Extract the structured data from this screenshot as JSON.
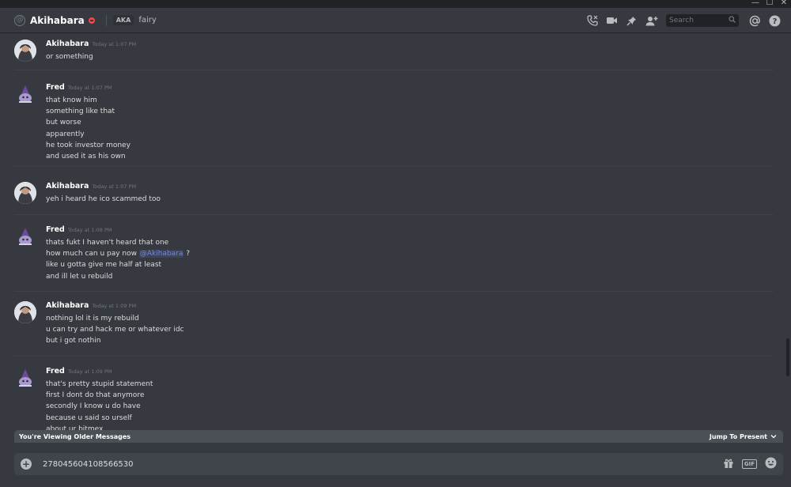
{
  "window": {
    "minimize": "—",
    "maximize": "☐",
    "close": "✕"
  },
  "header": {
    "name": "Akihabara",
    "aka_label": "AKA",
    "nickname": "fairy",
    "search_placeholder": "Search"
  },
  "messages": [
    {
      "author": "Akihabara",
      "avatar": "akihabara-avatar",
      "timestamp": "Today at 1:07 PM",
      "lines": [
        "or something"
      ]
    },
    {
      "author": "Fred",
      "avatar": "fred-avatar",
      "timestamp": "Today at 1:07 PM",
      "lines": [
        "that know him",
        "something like that",
        "but worse",
        "apparently",
        "he took investor money",
        "and used it as his own"
      ]
    },
    {
      "author": "Akihabara",
      "avatar": "akihabara-avatar",
      "timestamp": "Today at 1:07 PM",
      "lines": [
        "yeh i heard he ico scammed too"
      ]
    },
    {
      "author": "Fred",
      "avatar": "fred-avatar",
      "timestamp": "Today at 1:08 PM",
      "lines": [
        "thats fukt I haven't heard that one",
        "how much can u pay now",
        "like u gotta give me half at least",
        "and ill let u rebuild"
      ],
      "mention": "@Akihabara",
      "mention_suffix": "?"
    },
    {
      "author": "Akihabara",
      "avatar": "akihabara-avatar",
      "timestamp": "Today at 1:09 PM",
      "lines": [
        "nothing lol it is my rebuild",
        "u can try and hack me or whatever idc",
        "but i got nothin"
      ]
    },
    {
      "author": "Fred",
      "avatar": "fred-avatar",
      "timestamp": "Today at 1:09 PM",
      "lines": [
        "that's pretty stupid statement",
        "first I dont do that anymore",
        "secondly I know u do have",
        "because u said so urself",
        "about ur bitmex"
      ]
    }
  ],
  "older_bar": {
    "text": "You're Viewing Older Messages",
    "jump": "Jump To Present"
  },
  "composer": {
    "value": "278045604108566530",
    "gif": "GIF"
  },
  "colors": {
    "background": "#36393f",
    "mention": "#7289da",
    "dnd": "#f04747"
  }
}
